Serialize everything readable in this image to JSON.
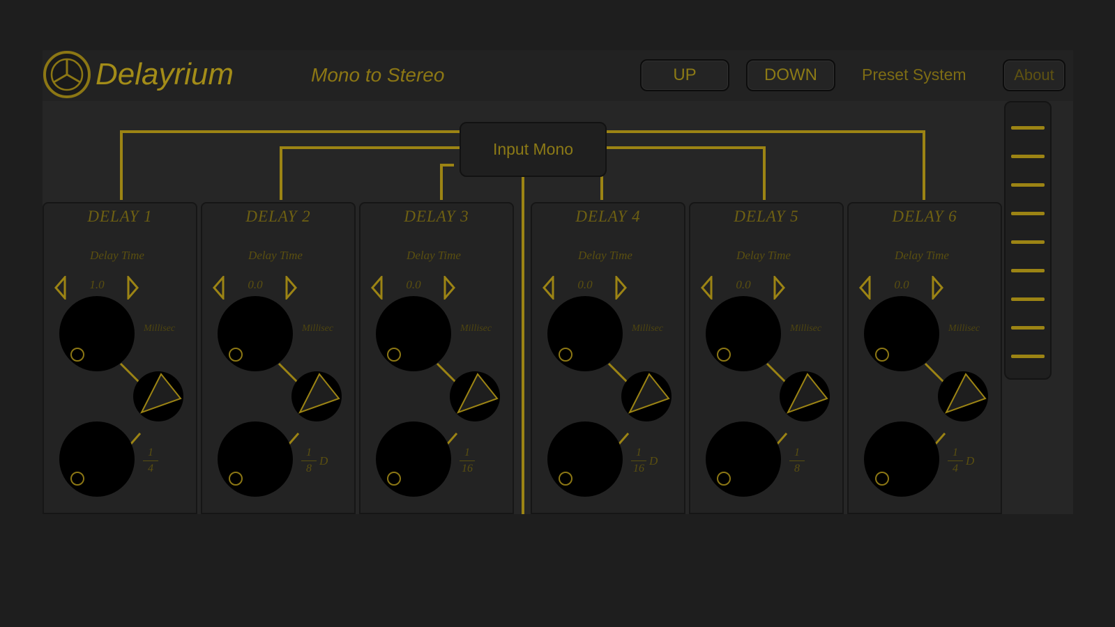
{
  "header": {
    "brand": "Delayrium",
    "mode_title": "Mono to Stereo",
    "up_label": "UP",
    "down_label": "DOWN",
    "preset_label": "Preset System",
    "about_label": "About"
  },
  "input_label": "Input Mono",
  "panels": [
    {
      "title": "DELAY 1",
      "delay_time_label": "Delay Time",
      "delay_value": "1.0",
      "millisec_label": "Millisec",
      "note_num": "1",
      "note_den": "4",
      "dotted": ""
    },
    {
      "title": "DELAY 2",
      "delay_time_label": "Delay Time",
      "delay_value": "0.0",
      "millisec_label": "Millisec",
      "note_num": "1",
      "note_den": "8",
      "dotted": "D"
    },
    {
      "title": "DELAY 3",
      "delay_time_label": "Delay Time",
      "delay_value": "0.0",
      "millisec_label": "Millisec",
      "note_num": "1",
      "note_den": "16",
      "dotted": ""
    },
    {
      "title": "DELAY 4",
      "delay_time_label": "Delay Time",
      "delay_value": "0.0",
      "millisec_label": "Millisec",
      "note_num": "1",
      "note_den": "16",
      "dotted": "D"
    },
    {
      "title": "DELAY 5",
      "delay_time_label": "Delay Time",
      "delay_value": "0.0",
      "millisec_label": "Millisec",
      "note_num": "1",
      "note_den": "8",
      "dotted": ""
    },
    {
      "title": "DELAY 6",
      "delay_time_label": "Delay Time",
      "delay_value": "0.0",
      "millisec_label": "Millisec",
      "note_num": "1",
      "note_den": "4",
      "dotted": "D"
    }
  ],
  "colors": {
    "accent": "#a38c18",
    "background": "#1e1e1e",
    "panel": "#232323",
    "knob": "#000000"
  },
  "icons": {
    "logo": "three-blade-circle-icon",
    "arrow_left": "left-triangle-icon",
    "arrow_right": "right-triangle-icon",
    "mode_switch": "triangle-selector-icon",
    "scroll": "scroll-line-icon"
  }
}
